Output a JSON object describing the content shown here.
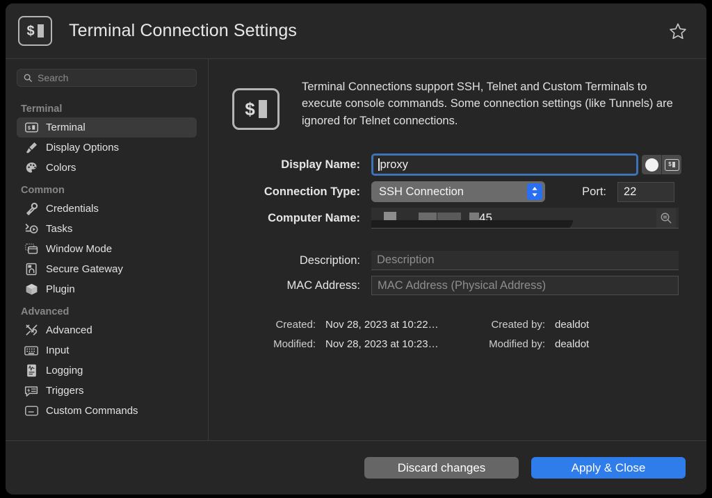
{
  "window": {
    "title": "Terminal Connection Settings",
    "title_icon": "terminal-icon",
    "favorite_icon": "star-outline-icon"
  },
  "sidebar": {
    "search": {
      "placeholder": "Search",
      "value": "",
      "icon": "search-icon"
    },
    "groups": [
      {
        "label": "Terminal",
        "items": [
          {
            "label": "Terminal",
            "icon": "terminal-icon",
            "selected": true
          },
          {
            "label": "Display Options",
            "icon": "paintbrush-icon",
            "selected": false
          },
          {
            "label": "Colors",
            "icon": "palette-icon",
            "selected": false
          }
        ]
      },
      {
        "label": "Common",
        "items": [
          {
            "label": "Credentials",
            "icon": "key-icon",
            "selected": false
          },
          {
            "label": "Tasks",
            "icon": "tasks-icon",
            "selected": false
          },
          {
            "label": "Window Mode",
            "icon": "windows-icon",
            "selected": false
          },
          {
            "label": "Secure Gateway",
            "icon": "gateway-lock-icon",
            "selected": false
          },
          {
            "label": "Plugin",
            "icon": "plugin-box-icon",
            "selected": false
          }
        ]
      },
      {
        "label": "Advanced",
        "items": [
          {
            "label": "Advanced",
            "icon": "tools-icon",
            "selected": false
          },
          {
            "label": "Input",
            "icon": "keyboard-icon",
            "selected": false
          },
          {
            "label": "Logging",
            "icon": "logging-icon",
            "selected": false
          },
          {
            "label": "Triggers",
            "icon": "triggers-icon",
            "selected": false
          },
          {
            "label": "Custom Commands",
            "icon": "custom-commands-icon",
            "selected": false
          }
        ]
      }
    ]
  },
  "main": {
    "intro": {
      "icon": "terminal-icon",
      "text": "Terminal Connections support SSH, Telnet and Custom Terminals to execute console commands. Some connection settings (like Tunnels) are ignored for Telnet connections."
    },
    "fields": {
      "display_name": {
        "label": "Display Name:",
        "value": "proxy",
        "focused": true,
        "color_swatch_icon": "color-circle-icon",
        "terminal_preset_icon": "terminal-icon"
      },
      "connection_type": {
        "label": "Connection Type:",
        "value": "SSH Connection",
        "stepper_icon": "chevron-up-down-icon"
      },
      "port": {
        "label": "Port:",
        "value": "22"
      },
      "computer_name": {
        "label": "Computer Name:",
        "value_visible_tail": "45",
        "redacted": true,
        "browse_icon": "magnifier-list-icon"
      },
      "description": {
        "label": "Description:",
        "placeholder": "Description",
        "value": ""
      },
      "mac_address": {
        "label": "MAC Address:",
        "placeholder": "MAC Address (Physical Address)",
        "value": ""
      }
    },
    "meta": {
      "created_label": "Created:",
      "created_value": "Nov 28, 2023 at 10:22…",
      "created_by_label": "Created by:",
      "created_by_value": "dealdot",
      "modified_label": "Modified:",
      "modified_value": "Nov 28, 2023 at 10:23…",
      "modified_by_label": "Modified by:",
      "modified_by_value": "dealdot"
    }
  },
  "footer": {
    "discard_label": "Discard changes",
    "apply_label": "Apply & Close"
  },
  "colors": {
    "accent_blue": "#2f7ceb",
    "focus_ring": "#3f73b8",
    "window_bg": "#262626",
    "selected_row": "#3a3a3a"
  }
}
